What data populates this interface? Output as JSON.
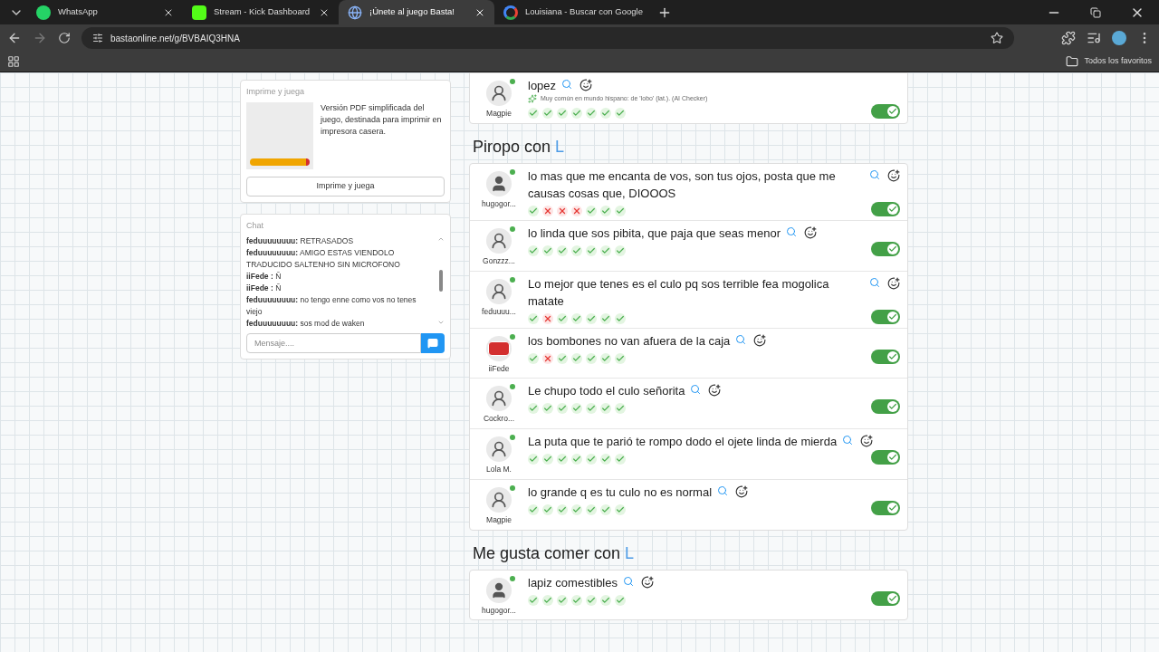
{
  "browser": {
    "tabs": [
      {
        "kind": "whatsapp",
        "title": "WhatsApp",
        "selected": false
      },
      {
        "kind": "kick",
        "title": "Stream - Kick Dashboard",
        "selected": false
      },
      {
        "kind": "globe",
        "title": "¡Únete al juego Basta!",
        "selected": true
      },
      {
        "kind": "google",
        "title": "Louisiana - Buscar con Google",
        "selected": false
      }
    ],
    "url": "bastaonline.net/g/BVBAIQ3HNA",
    "bookmarks_label": "Todos los favoritos"
  },
  "print_card": {
    "title": "Imprime y juega",
    "description": "Versión PDF simplificada del juego, destinada para imprimir en impresora casera.",
    "button": "Imprime y juega"
  },
  "chat": {
    "title": "Chat",
    "messages": [
      {
        "user": "feduuuuuuuu:",
        "text": "RETRASADOS"
      },
      {
        "user": "feduuuuuuuu:",
        "text": "AMIGO ESTAS VIENDOLO TRADUCIDO SALTENHO SIN MICROFONO"
      },
      {
        "user": "iiFede :",
        "text": "Ñ"
      },
      {
        "user": "iiFede :",
        "text": "Ñ"
      },
      {
        "user": "feduuuuuuuu:",
        "text": "no tengo enne como vos no tenes viejo"
      },
      {
        "user": "feduuuuuuuu:",
        "text": "sos mod de waken"
      }
    ],
    "placeholder": "Mensaje...."
  },
  "sections": [
    {
      "answers": [
        {
          "kind": "person",
          "user": "Magpie",
          "answer": "lopez",
          "note": "Muy común en mundo hispano: de 'lobo' (lat.). (AI Checker)",
          "votes": [
            {
              "ok": true
            },
            {
              "ok": true
            },
            {
              "ok": true
            },
            {
              "ok": true
            },
            {
              "ok": true
            },
            {
              "ok": true
            },
            {
              "ok": true
            }
          ],
          "on": true
        }
      ]
    },
    {
      "title": "Piropo con",
      "letter": "L",
      "answers": [
        {
          "kind": "person-star",
          "user": "hugogor...",
          "answer": "lo mas que me encanta de vos, son tus ojos, posta que me causas cosas que, DIOOOS",
          "votes": [
            {
              "ok": true
            },
            {
              "ok": false
            },
            {
              "ok": false
            },
            {
              "ok": false
            },
            {
              "ok": true
            },
            {
              "ok": true
            },
            {
              "ok": true
            }
          ],
          "on": true
        },
        {
          "kind": "person",
          "user": "Gonzzz...",
          "answer": "lo linda que sos pibita, que paja que seas menor",
          "votes": [
            {
              "ok": true
            },
            {
              "ok": true
            },
            {
              "ok": true
            },
            {
              "ok": true
            },
            {
              "ok": true
            },
            {
              "ok": true
            },
            {
              "ok": true
            }
          ],
          "on": true
        },
        {
          "kind": "person",
          "user": "feduuuu...",
          "answer": "Lo mejor que tenes es el culo pq sos terrible fea mogolica matate",
          "votes": [
            {
              "ok": true
            },
            {
              "ok": false
            },
            {
              "ok": true
            },
            {
              "ok": true
            },
            {
              "ok": true
            },
            {
              "ok": true
            },
            {
              "ok": true
            }
          ],
          "on": true
        },
        {
          "kind": "stop",
          "user": "iiFede",
          "answer": "los bombones no van afuera de la caja",
          "votes": [
            {
              "ok": true
            },
            {
              "ok": false
            },
            {
              "ok": true
            },
            {
              "ok": true
            },
            {
              "ok": true
            },
            {
              "ok": true
            },
            {
              "ok": true
            }
          ],
          "on": true
        },
        {
          "kind": "person",
          "user": "Cockro...",
          "answer": "Le chupo todo el culo señorita",
          "votes": [
            {
              "ok": true
            },
            {
              "ok": true
            },
            {
              "ok": true
            },
            {
              "ok": true
            },
            {
              "ok": true
            },
            {
              "ok": true
            },
            {
              "ok": true
            }
          ],
          "on": true
        },
        {
          "kind": "person",
          "user": "Lola M.",
          "answer": "La puta que te parió te rompo dodo el ojete linda de mierda",
          "votes": [
            {
              "ok": true
            },
            {
              "ok": true
            },
            {
              "ok": true
            },
            {
              "ok": true
            },
            {
              "ok": true
            },
            {
              "ok": true
            },
            {
              "ok": true
            }
          ],
          "on": true
        },
        {
          "kind": "person",
          "user": "Magpie",
          "answer": "lo grande q es tu culo no es normal",
          "votes": [
            {
              "ok": true
            },
            {
              "ok": true
            },
            {
              "ok": true
            },
            {
              "ok": true
            },
            {
              "ok": true
            },
            {
              "ok": true
            },
            {
              "ok": true
            }
          ],
          "on": true
        }
      ]
    },
    {
      "title": "Me gusta comer con",
      "letter": "L",
      "answers": [
        {
          "kind": "person-star",
          "user": "hugogor...",
          "answer": "lapiz comestibles",
          "votes": [
            {
              "ok": true
            },
            {
              "ok": true
            },
            {
              "ok": true
            },
            {
              "ok": true
            },
            {
              "ok": true
            },
            {
              "ok": true
            },
            {
              "ok": true
            }
          ],
          "on": true
        }
      ]
    }
  ]
}
